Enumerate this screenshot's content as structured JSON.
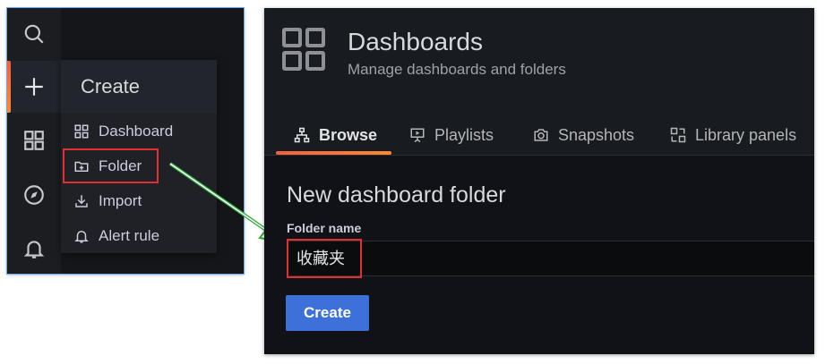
{
  "create_menu": {
    "header": "Create",
    "items": [
      {
        "label": "Dashboard",
        "icon": "apps-icon"
      },
      {
        "label": "Folder",
        "icon": "folder-plus-icon"
      },
      {
        "label": "Import",
        "icon": "import-icon"
      },
      {
        "label": "Alert rule",
        "icon": "bell-icon"
      }
    ]
  },
  "sidenav": {
    "items": [
      "search-icon",
      "plus-icon",
      "apps-icon",
      "compass-icon",
      "bell-icon"
    ]
  },
  "page": {
    "title": "Dashboards",
    "subtitle": "Manage dashboards and folders",
    "tabs": [
      {
        "label": "Browse",
        "icon": "sitemap-icon",
        "active": true
      },
      {
        "label": "Playlists",
        "icon": "presentation-icon",
        "active": false
      },
      {
        "label": "Snapshots",
        "icon": "camera-icon",
        "active": false
      },
      {
        "label": "Library panels",
        "icon": "library-panel-icon",
        "active": false
      }
    ]
  },
  "form": {
    "section_title": "New dashboard folder",
    "folder_name_label": "Folder name",
    "folder_name_value": "收藏夹",
    "create_button": "Create"
  },
  "colors": {
    "accent_orange": "#f55f3e",
    "primary_blue": "#3d71d9",
    "highlight_red": "#e02f2f",
    "arrow_green": "#2eaa3a"
  }
}
